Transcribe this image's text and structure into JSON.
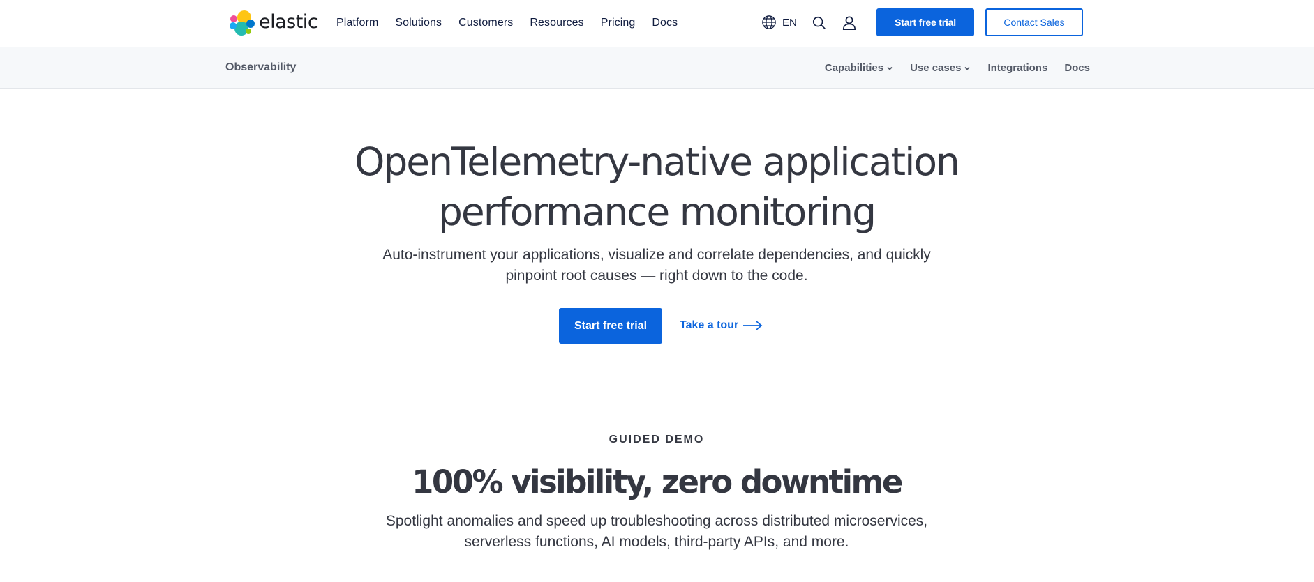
{
  "brand": {
    "name": "elastic"
  },
  "topnav": {
    "links": [
      "Platform",
      "Solutions",
      "Customers",
      "Resources",
      "Pricing",
      "Docs"
    ],
    "language": "EN",
    "trial_label": "Start free trial",
    "contact_label": "Contact Sales"
  },
  "subnav": {
    "title": "Observability",
    "links": [
      {
        "label": "Capabilities",
        "dropdown": true
      },
      {
        "label": "Use cases",
        "dropdown": true
      },
      {
        "label": "Integrations",
        "dropdown": false
      },
      {
        "label": "Docs",
        "dropdown": false
      }
    ]
  },
  "hero": {
    "title_line1": "OpenTelemetry-native application",
    "title_line2": "performance monitoring",
    "subtitle_line1": "Auto-instrument your applications, visualize and correlate dependencies, and quickly",
    "subtitle_line2": "pinpoint root causes — right down to the code.",
    "cta_label": "Start free trial",
    "tour_label": "Take a tour"
  },
  "demo": {
    "eyebrow": "GUIDED DEMO",
    "title": "100% visibility, zero downtime",
    "subtitle_line1": "Spotlight anomalies and speed up troubleshooting across distributed microservices,",
    "subtitle_line2": "serverless functions, AI models, third-party APIs, and more."
  },
  "colors": {
    "accent": "#0b64dd",
    "text": "#343741",
    "nav_text": "#101c3f",
    "subnav_bg": "#f6f8fa"
  },
  "icons": [
    "elastic-logo-icon",
    "globe-icon",
    "search-icon",
    "user-icon",
    "chevron-down-icon",
    "arrow-right-icon"
  ]
}
